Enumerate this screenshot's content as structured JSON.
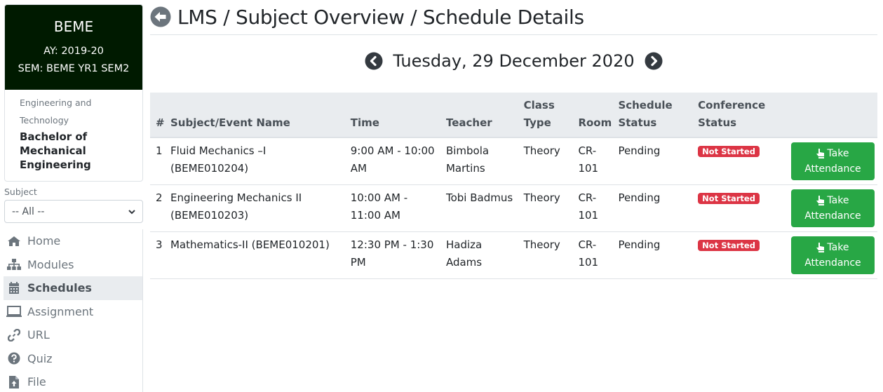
{
  "sidebar": {
    "program_code": "BEME",
    "academic_year": "AY: 2019-20",
    "semester": "SEM: BEME YR1 SEM2",
    "faculty": "Engineering and Technology",
    "program_name": "Bachelor of Mechanical Engineering",
    "subject_label": "Subject",
    "subject_selected": "-- All --",
    "nav": [
      {
        "label": "Home",
        "icon": "home-icon",
        "active": false
      },
      {
        "label": "Modules",
        "icon": "sitemap-icon",
        "active": false
      },
      {
        "label": "Schedules",
        "icon": "calendar-icon",
        "active": true
      },
      {
        "label": "Assignment",
        "icon": "laptop-icon",
        "active": false
      },
      {
        "label": "URL",
        "icon": "link-icon",
        "active": false
      },
      {
        "label": "Quiz",
        "icon": "question-circle-icon",
        "active": false
      },
      {
        "label": "File",
        "icon": "file-upload-icon",
        "active": false
      }
    ]
  },
  "header": {
    "title": "LMS / Subject Overview / Schedule Details"
  },
  "date_nav": {
    "date": "Tuesday, 29 December 2020"
  },
  "table": {
    "headers": {
      "num": "#",
      "subject": "Subject/Event Name",
      "time": "Time",
      "teacher": "Teacher",
      "class_type": "Class Type",
      "room": "Room",
      "schedule_status": "Schedule Status",
      "conference_status": "Conference Status",
      "action": ""
    },
    "rows": [
      {
        "num": "1",
        "subject": "Fluid Mechanics –I (BEME010204)",
        "time": "9:00 AM - 10:00 AM",
        "teacher": "Bimbola Martins",
        "class_type": "Theory",
        "room": "CR-101",
        "schedule_status": "Pending",
        "conference_status": "Not Started",
        "action_line1": "Take",
        "action_line2": "Attendance"
      },
      {
        "num": "2",
        "subject": "Engineering Mechanics II (BEME010203)",
        "time": "10:00 AM - 11:00 AM",
        "teacher": "Tobi Badmus",
        "class_type": "Theory",
        "room": "CR-101",
        "schedule_status": "Pending",
        "conference_status": "Not Started",
        "action_line1": "Take",
        "action_line2": "Attendance"
      },
      {
        "num": "3",
        "subject": "Mathematics-II (BEME010201)",
        "time": "12:30 PM - 1:30 PM",
        "teacher": "Hadiza Adams",
        "class_type": "Theory",
        "room": "CR-101",
        "schedule_status": "Pending",
        "conference_status": "Not Started",
        "action_line1": "Take",
        "action_line2": "Attendance"
      }
    ]
  },
  "colors": {
    "card_header": "#001a00",
    "badge_danger": "#dc3545",
    "button_success": "#28a745",
    "active_nav_bg": "#e9ecef"
  }
}
